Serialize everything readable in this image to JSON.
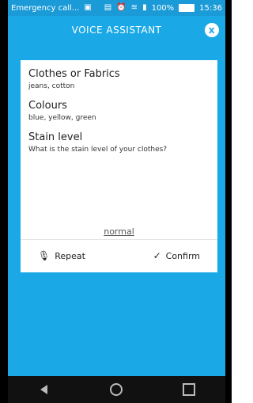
{
  "status_bar": {
    "left_text": "Emergency call...",
    "notification_icon": "image-icon",
    "icons": [
      "sim-icon",
      "alarm-icon",
      "wifi-icon",
      "signal-icon"
    ],
    "battery_percent": "100%",
    "time": "15:36"
  },
  "header": {
    "title": "VOICE ASSISTANT",
    "close_icon": "x"
  },
  "card": {
    "fields": [
      {
        "title": "Clothes or Fabrics",
        "value": "jeans, cotton"
      },
      {
        "title": "Colours",
        "value": "blue, yellow, green"
      },
      {
        "title": "Stain level",
        "value": "What is the stain level of your clothes?"
      }
    ],
    "answer": "normal",
    "actions": {
      "repeat_label": "Repeat",
      "confirm_label": "Confirm"
    }
  },
  "colors": {
    "primary": "#1aa9e6",
    "statusbar": "#1a9ad7",
    "navbar": "#111111"
  }
}
